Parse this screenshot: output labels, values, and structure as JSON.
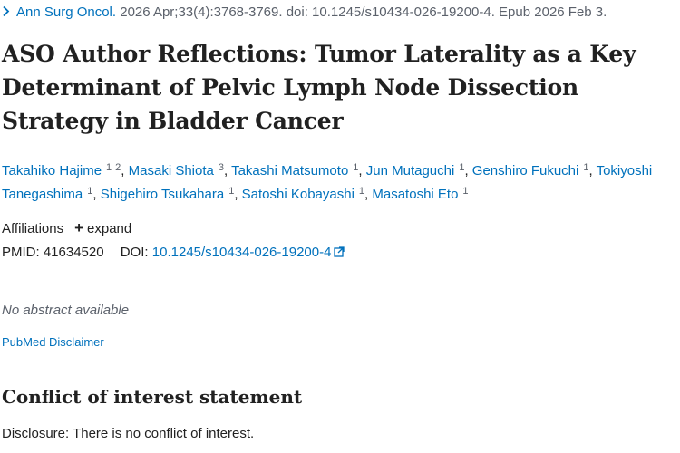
{
  "citation": {
    "journal": "Ann Surg Oncol.",
    "details": " 2026 Apr;33(4):3768-3769. doi: 10.1245/s10434-026-19200-4. Epub 2026 Feb 3.",
    "chevron_icon": "chevron-right-icon"
  },
  "article": {
    "title": "ASO Author Reflections: Tumor Laterality as a Key Determinant of Pelvic Lymph Node Dissection Strategy in Bladder Cancer"
  },
  "authors": [
    {
      "name": "Takahiko Hajime",
      "affils": [
        "1",
        "2"
      ]
    },
    {
      "name": "Masaki Shiota",
      "affils": [
        "3"
      ]
    },
    {
      "name": "Takashi Matsumoto",
      "affils": [
        "1"
      ]
    },
    {
      "name": "Jun Mutaguchi",
      "affils": [
        "1"
      ]
    },
    {
      "name": "Genshiro Fukuchi",
      "affils": [
        "1"
      ]
    },
    {
      "name": "Tokiyoshi Tanegashima",
      "affils": [
        "1"
      ]
    },
    {
      "name": "Shigehiro Tsukahara",
      "affils": [
        "1"
      ]
    },
    {
      "name": "Satoshi Kobayashi",
      "affils": [
        "1"
      ]
    },
    {
      "name": "Masatoshi Eto",
      "affils": [
        "1"
      ]
    }
  ],
  "affiliations": {
    "label": "Affiliations",
    "expand_label": "expand"
  },
  "identifiers": {
    "pmid_label": "PMID:",
    "pmid": "41634520",
    "doi_label": "DOI:",
    "doi": "10.1245/s10434-026-19200-4"
  },
  "abstract": {
    "text": "No abstract available"
  },
  "disclaimer": {
    "label": "PubMed Disclaimer"
  },
  "conflict": {
    "heading": "Conflict of interest statement",
    "text": "Disclosure: There is no conflict of interest."
  },
  "colors": {
    "link": "#0071bc",
    "text": "#212121",
    "muted": "#5b616b"
  }
}
